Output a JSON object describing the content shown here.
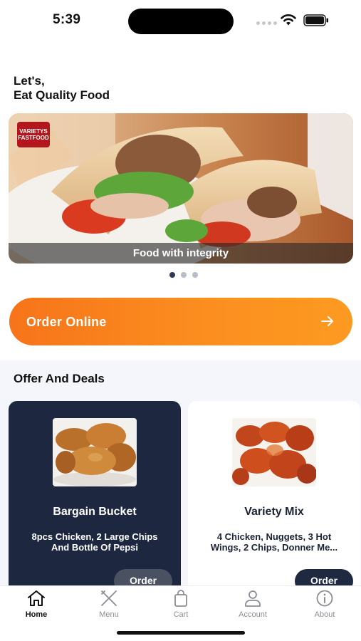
{
  "status": {
    "time": "5:39"
  },
  "greeting": {
    "line1": "Let's,",
    "line2": "Eat Quality Food"
  },
  "banner": {
    "caption": "Food with integrity",
    "logo_line1": "VARIETYS",
    "logo_line2": "FASTFOOD",
    "slide_count": 3,
    "active_slide": 0
  },
  "order_online": {
    "label": "Order Online",
    "icon": "arrow-right-icon"
  },
  "offers": {
    "title": "Offer And Deals",
    "cards": [
      {
        "title": "Bargain Bucket",
        "desc_line1": "8pcs Chicken, 2 Large Chips",
        "desc_line2": "And Bottle Of Pepsi",
        "button": "Order",
        "image": "fried-chicken"
      },
      {
        "title": "Variety Mix",
        "desc_line1": "4 Chicken, Nuggets, 3 Hot",
        "desc_line2": "Wings, 2 Chips, Donner Me...",
        "button": "Order",
        "image": "hot-wings"
      }
    ]
  },
  "tabs": [
    {
      "label": "Home",
      "icon": "home-icon",
      "active": true
    },
    {
      "label": "Menu",
      "icon": "fork-knife-icon",
      "active": false
    },
    {
      "label": "Cart",
      "icon": "bag-icon",
      "active": false
    },
    {
      "label": "Account",
      "icon": "person-icon",
      "active": false
    },
    {
      "label": "About",
      "icon": "info-icon",
      "active": false
    }
  ],
  "colors": {
    "accent": "#f7741a",
    "dark_card": "#1d2740",
    "accent_red": "#e0242d"
  }
}
